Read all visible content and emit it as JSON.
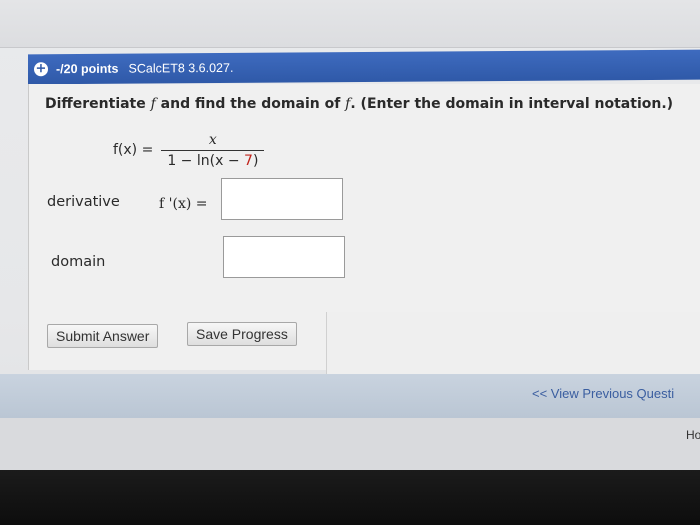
{
  "header": {
    "expand_symbol": "+",
    "points": "-/20 points",
    "code": "SCalcET8 3.6.027."
  },
  "question": {
    "prompt_before": "Differentiate ",
    "prompt_f1": "f",
    "prompt_middle": " and find the domain of ",
    "prompt_f2": "f",
    "prompt_after": ". (Enter the domain in interval notation.)",
    "lhs": "f(x) =",
    "numerator": "x",
    "denominator_start": "1 − ln(x − ",
    "denominator_red": "7",
    "denominator_end": ")"
  },
  "rows": {
    "derivative_label": "derivative",
    "fprime_label": "f '(x) =",
    "domain_label": "domain"
  },
  "buttons": {
    "submit": "Submit Answer",
    "save": "Save Progress"
  },
  "footer": {
    "previous": "<< View Previous Questi",
    "home": "Ho"
  },
  "colors": {
    "header_blue": "#2f59a8",
    "highlight_red": "#c0241c",
    "link_blue": "#3a5ea0"
  }
}
